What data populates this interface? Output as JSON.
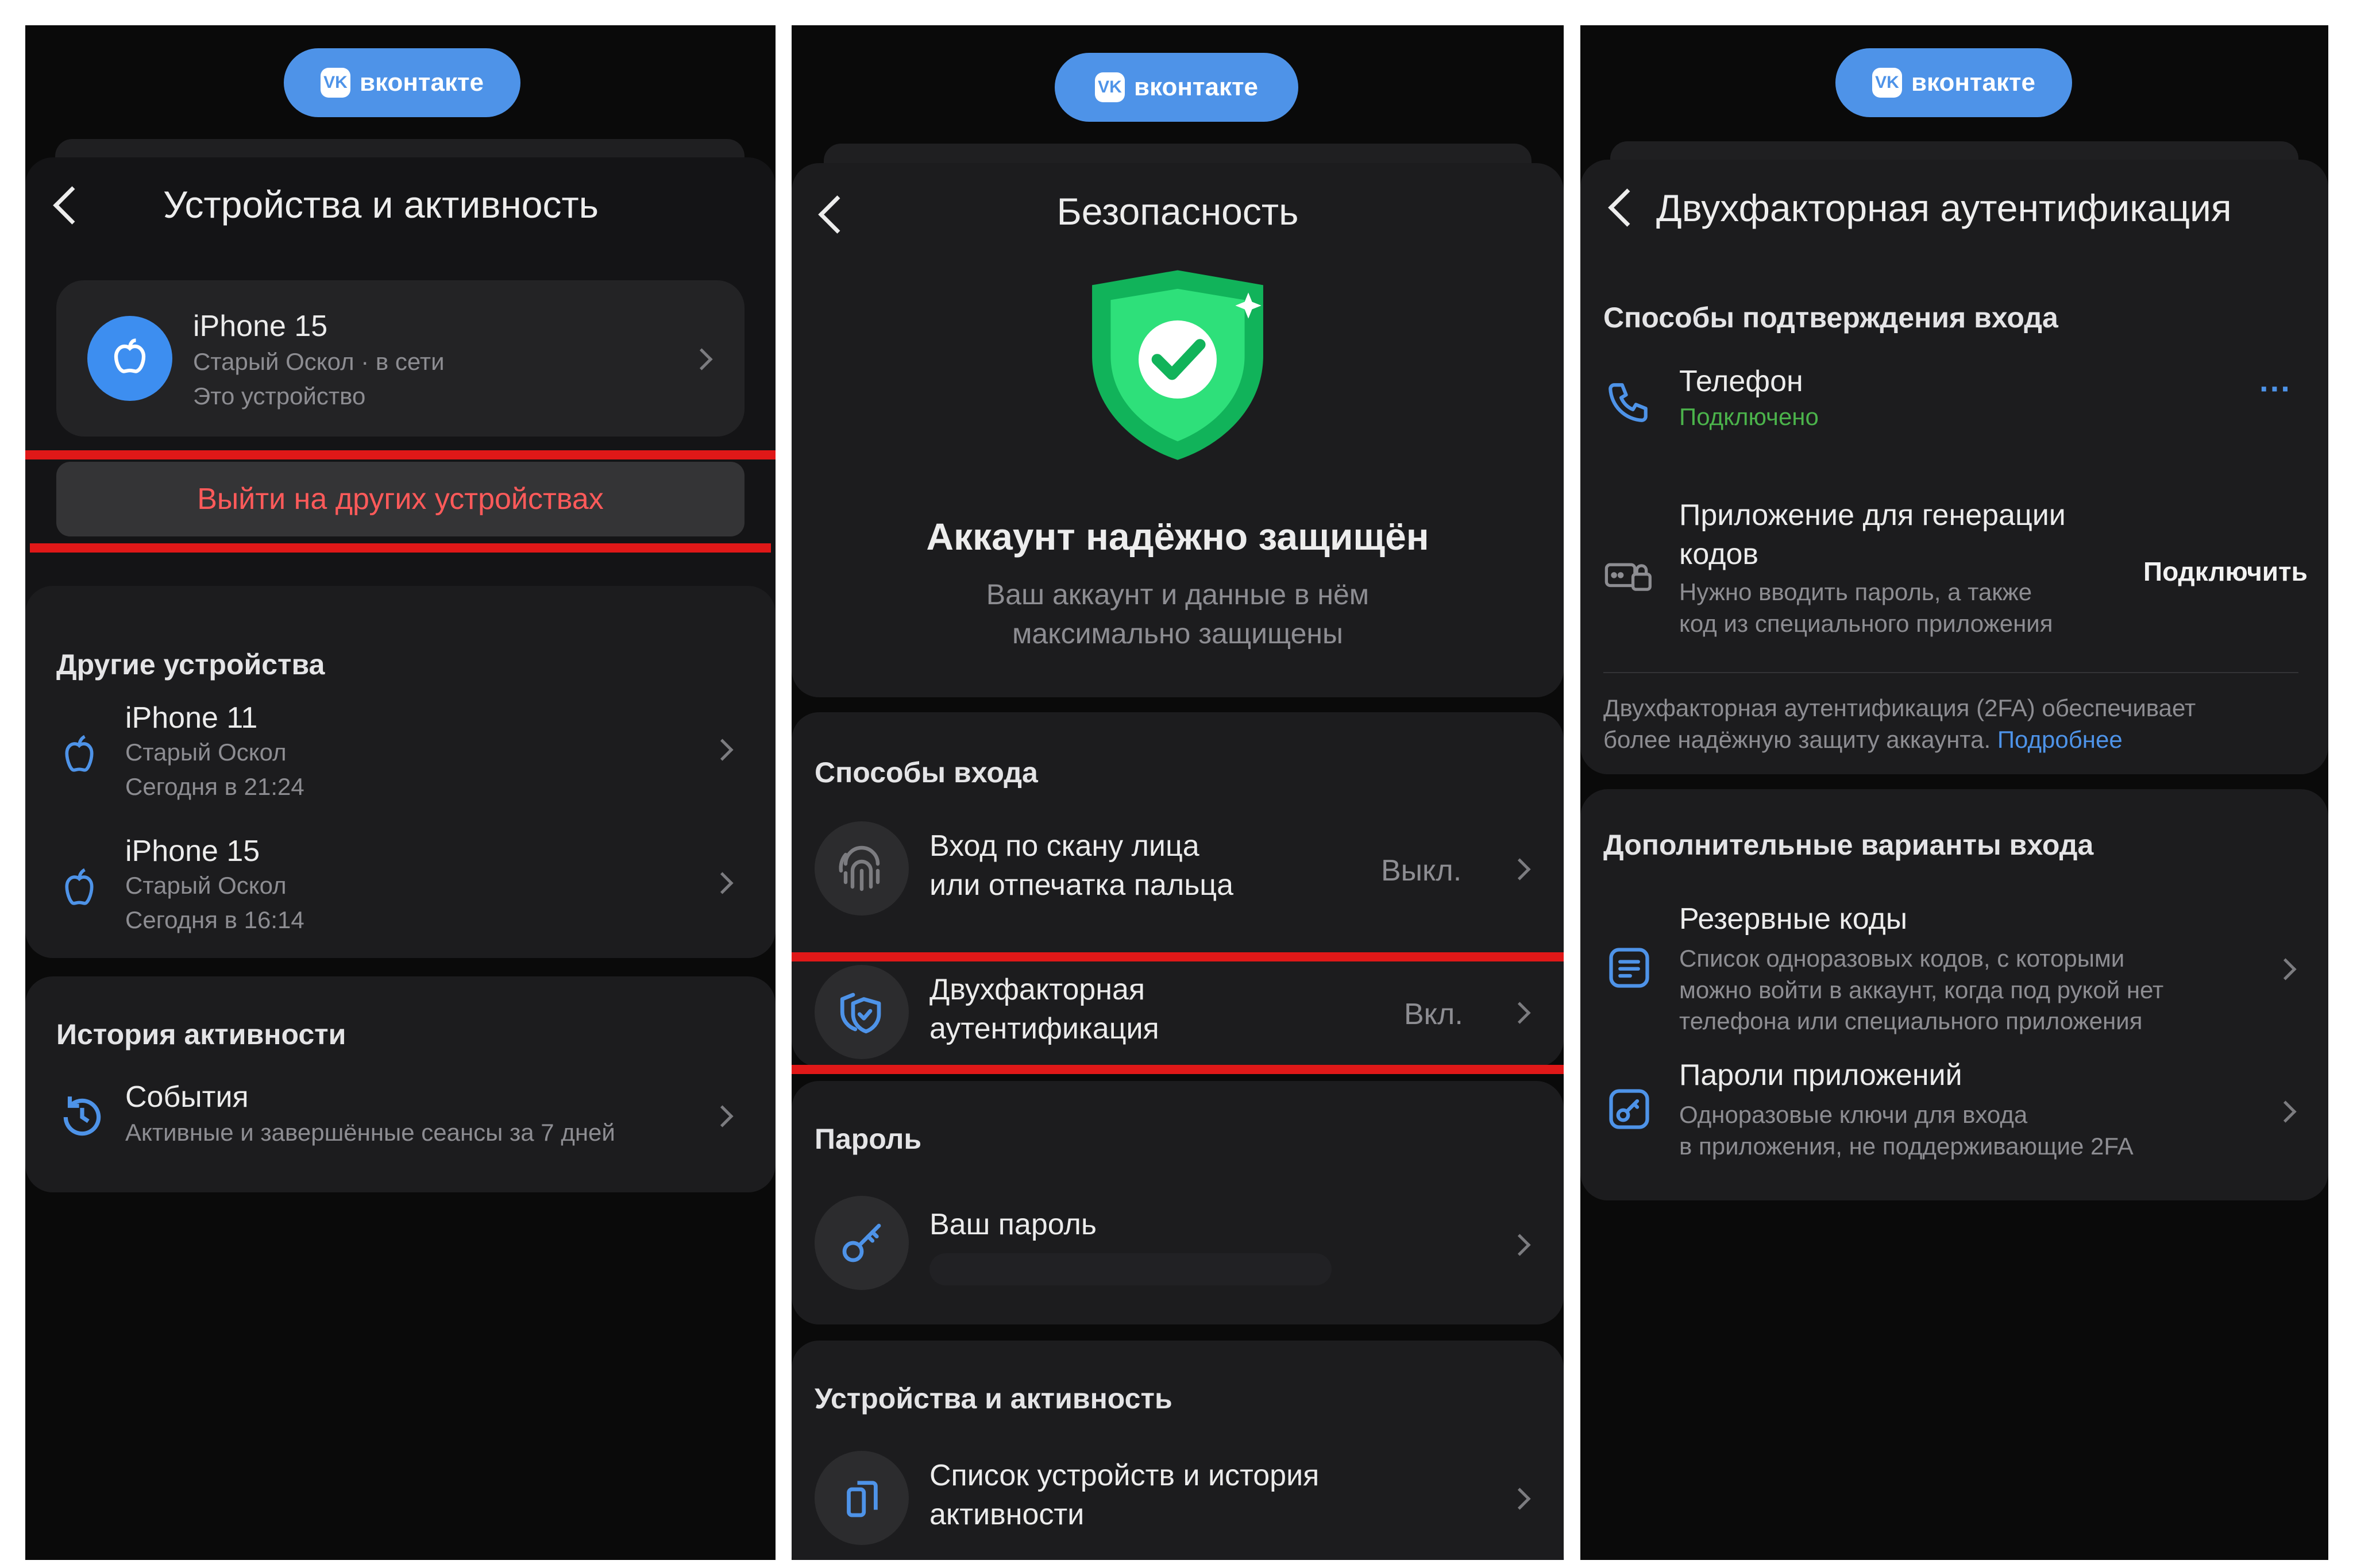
{
  "brand": {
    "label": "вконтакте",
    "logo": "VK",
    "accent": "#4e93e8"
  },
  "colors": {
    "background": "#0a0a0a",
    "card": "#1c1c1e",
    "highlight": "#e01818",
    "danger_text": "#ff5a5a",
    "connected": "#4bb34b",
    "link": "#4e93e8"
  },
  "screen1": {
    "title": "Устройства и активность",
    "current_device": {
      "name": "iPhone 15",
      "line1": "Старый Оскол · в сети",
      "line2": "Это устройство",
      "icon": "apple-icon"
    },
    "logout_others": "Выйти на других устройствах",
    "other_devices": {
      "header": "Другие устройства",
      "items": [
        {
          "name": "iPhone 11",
          "line1": "Старый Оскол",
          "line2": "Сегодня в 21:24",
          "icon": "apple-icon"
        },
        {
          "name": "iPhone 15",
          "line1": "Старый Оскол",
          "line2": "Сегодня в 16:14",
          "icon": "apple-icon"
        }
      ]
    },
    "history": {
      "header": "История активности",
      "item": {
        "title": "События",
        "subtitle": "Активные и завершённые сеансы за 7 дней",
        "icon": "history-icon"
      }
    }
  },
  "screen2": {
    "title": "Безопасность",
    "status_title": "Аккаунт надёжно защищён",
    "status_text_1": "Ваш аккаунт и данные в нём",
    "status_text_2": "максимально защищены",
    "login_methods": {
      "header": "Способы входа",
      "items": [
        {
          "line1": "Вход по скану лица",
          "line2": "или отпечатка пальца",
          "value": "Выкл.",
          "icon": "fingerprint-icon"
        },
        {
          "line1": "Двухфакторная",
          "line2": "аутентификация",
          "value": "Вкл.",
          "icon": "shield-check-icon"
        }
      ]
    },
    "password": {
      "header": "Пароль",
      "item": "Ваш пароль",
      "icon": "key-icon"
    },
    "devices": {
      "header": "Устройства и активность",
      "line1": "Список устройств и история",
      "line2": "активности",
      "icon": "devices-icon"
    }
  },
  "screen3": {
    "title": "Двухфакторная аутентификация",
    "confirm_header": "Способы подтверждения входа",
    "phone": {
      "title": "Телефон",
      "status": "Подключено",
      "icon": "phone-icon",
      "menu": "···"
    },
    "app": {
      "title_1": "Приложение для генерации",
      "title_2": "кодов",
      "desc_1": "Нужно вводить пароль, а также",
      "desc_2": "код из специального приложения",
      "action": "Подключить",
      "icon": "code-generator-icon"
    },
    "info_1": "Двухфакторная аутентификация (2FA) обеспечивает",
    "info_2": "более надёжную защиту аккаунта.",
    "info_link": "Подробнее",
    "extra_header": "Дополнительные варианты входа",
    "backup": {
      "title": "Резервные коды",
      "desc_1": "Список одноразовых кодов, с которыми",
      "desc_2": "можно войти в аккаунт, когда под рукой нет",
      "desc_3": "телефона или специального приложения",
      "icon": "list-icon"
    },
    "app_passwords": {
      "title": "Пароли приложений",
      "desc_1": "Одноразовые ключи для входа",
      "desc_2": "в приложения, не поддерживающие 2FA",
      "icon": "app-key-icon"
    }
  }
}
